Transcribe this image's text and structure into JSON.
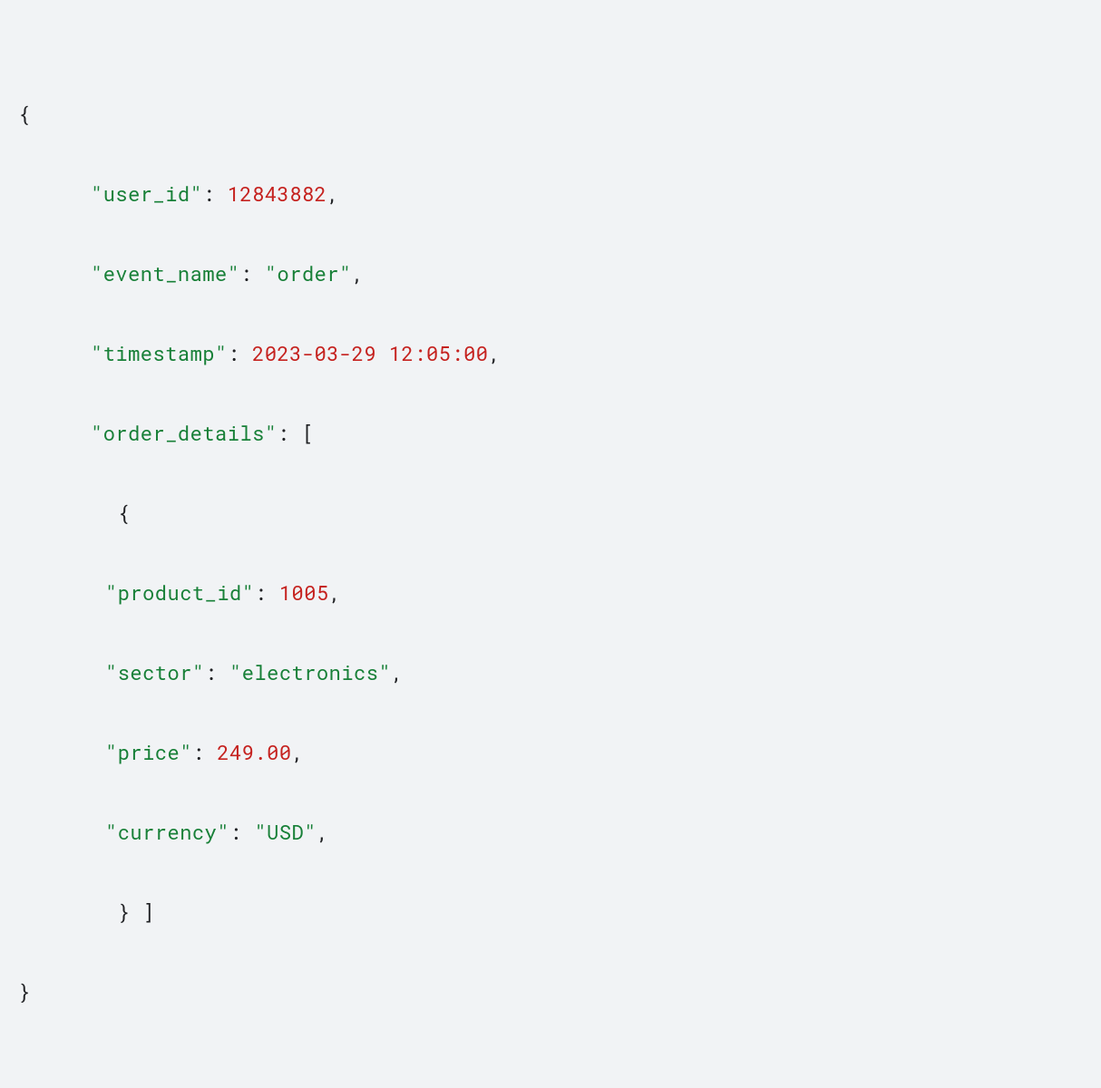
{
  "code": {
    "open_brace": "{",
    "close_brace": "}",
    "line1": {
      "key": "\"user_id\"",
      "colon": ": ",
      "value": "12843882",
      "comma": ","
    },
    "line2": {
      "key": "\"event_name\"",
      "colon": ": ",
      "value": "\"order\"",
      "comma": ","
    },
    "line3": {
      "key": "\"timestamp\"",
      "colon": ": ",
      "value": "2023-03-29 12:05:00",
      "comma": ","
    },
    "line4": {
      "key": "\"order_details\"",
      "colon": ": ",
      "bracket": "["
    },
    "line5": {
      "brace": " {"
    },
    "line6": {
      "key": "\"product_id\"",
      "colon": ": ",
      "value": "1005",
      "comma": ","
    },
    "line7": {
      "key": "\"sector\"",
      "colon": ": ",
      "value": "\"electronics\"",
      "comma": ","
    },
    "line8": {
      "key": "\"price\"",
      "colon": ": ",
      "value": "249.00",
      "comma": ","
    },
    "line9": {
      "key": "\"currency\"",
      "colon": ": ",
      "value": "\"USD\"",
      "comma": ","
    },
    "line10": {
      "close": " } ]"
    }
  }
}
